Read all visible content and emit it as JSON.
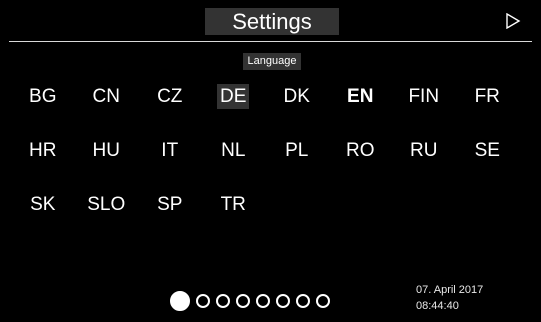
{
  "header": {
    "title": "Settings",
    "next_icon": "play-triangle-outline-icon"
  },
  "section_label": "Language",
  "languages": [
    "BG",
    "CN",
    "CZ",
    "DE",
    "DK",
    "EN",
    "FIN",
    "FR",
    "HR",
    "HU",
    "IT",
    "NL",
    "PL",
    "RO",
    "RU",
    "SE",
    "SK",
    "SLO",
    "SP",
    "TR"
  ],
  "highlighted_language": "DE",
  "selected_language": "EN",
  "pager": {
    "total_pages": 8,
    "current_page": 1
  },
  "status": {
    "date": "07. April 2017",
    "time": "08:44:40"
  },
  "colors": {
    "background": "#000000",
    "highlight": "#333333",
    "text": "#ffffff"
  }
}
